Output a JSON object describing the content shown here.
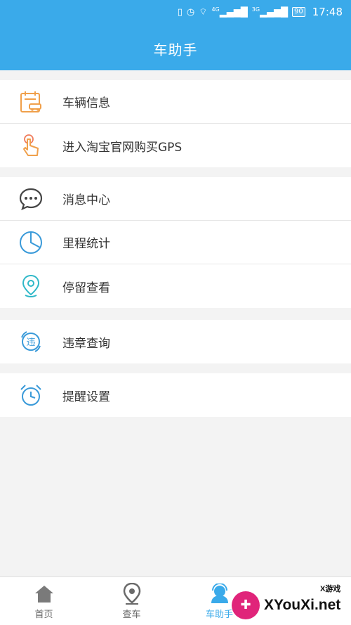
{
  "status_bar": {
    "time": "17:48",
    "battery": "90",
    "net1": "4G",
    "net2": "3G"
  },
  "header": {
    "title": "车助手"
  },
  "groups": [
    {
      "items": [
        {
          "label": "车辆信息",
          "icon": "car-calendar-icon"
        },
        {
          "label": "进入淘宝官网购买GPS",
          "icon": "hand-tap-icon"
        }
      ]
    },
    {
      "items": [
        {
          "label": "消息中心",
          "icon": "chat-bubble-icon"
        },
        {
          "label": "里程统计",
          "icon": "pie-chart-icon"
        },
        {
          "label": "停留查看",
          "icon": "location-pin-icon"
        }
      ]
    },
    {
      "items": [
        {
          "label": "违章查询",
          "icon": "violation-search-icon",
          "icon_text": "违"
        }
      ]
    },
    {
      "items": [
        {
          "label": "提醒设置",
          "icon": "alarm-clock-icon"
        }
      ]
    }
  ],
  "tabbar": {
    "tabs": [
      {
        "label": "首页",
        "icon": "home-icon",
        "active": false
      },
      {
        "label": "查车",
        "icon": "map-pin-icon",
        "active": false
      },
      {
        "label": "车助手",
        "icon": "assistant-icon",
        "active": true
      }
    ]
  },
  "watermark": {
    "text": "XYouXi.net",
    "tag": "X游戏"
  },
  "colors": {
    "accent": "#3aaaea",
    "icon_orange": "#f0a04b",
    "icon_blue": "#3a9ad9",
    "text": "#333333"
  }
}
